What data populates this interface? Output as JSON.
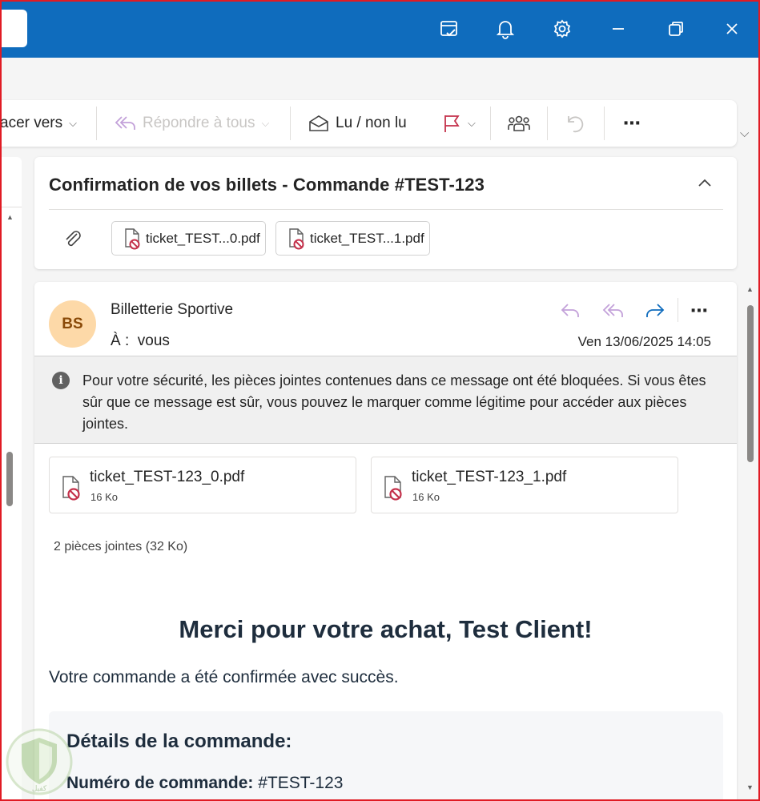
{
  "ribbon": {
    "move_to": "acer vers",
    "reply_all": "Répondre à tous",
    "read_unread": "Lu / non lu"
  },
  "subject": {
    "title": "Confirmation de vos billets - Commande #TEST-123",
    "attachments": [
      "ticket_TEST...0.pdf",
      "ticket_TEST...1.pdf"
    ]
  },
  "message": {
    "avatar_initials": "BS",
    "sender": "Billetterie Sportive",
    "to_label": "À :",
    "to_value": "vous",
    "date": "Ven 13/06/2025 14:05",
    "warning": "Pour votre sécurité, les pièces jointes contenues dans ce message ont été bloquées. Si vous êtes sûr que ce message est sûr, vous pouvez le marquer comme légitime pour accéder aux pièces jointes.",
    "files": [
      {
        "name": "ticket_TEST-123_0.pdf",
        "size": "16 Ko"
      },
      {
        "name": "ticket_TEST-123_1.pdf",
        "size": "16 Ko"
      }
    ],
    "attachment_count": "2 pièces jointes (32 Ko)"
  },
  "body": {
    "title": "Merci pour votre achat, Test Client!",
    "subtitle": "Votre commande a été confirmée avec succès.",
    "details_title": "Détails de la commande:",
    "order_label": "Numéro de commande:",
    "order_value": "#TEST-123"
  },
  "colors": {
    "titlebar": "#0f6cbd",
    "accent_blue": "#0f6cbd",
    "flag_red": "#c4314b",
    "reply_purple": "#c3a1d9",
    "avatar_bg": "#fdd9a8"
  },
  "watermark_text": "كفيل"
}
